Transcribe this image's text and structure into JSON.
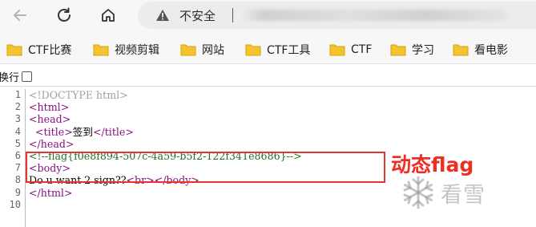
{
  "browser": {
    "security_label": "不安全",
    "nav": {
      "back_icon": "arrow-left-icon",
      "reload_icon": "reload-icon",
      "home_icon": "home-icon",
      "warn_icon": "warning-triangle-icon"
    }
  },
  "bookmarks": [
    {
      "label": "CTF比赛"
    },
    {
      "label": "视频剪辑"
    },
    {
      "label": "网站"
    },
    {
      "label": "CTF工具"
    },
    {
      "label": "CTF"
    },
    {
      "label": "学习"
    },
    {
      "label": "看电影"
    }
  ],
  "source_view": {
    "wrap_label": "换行",
    "wrap_checked": false,
    "line_numbers": [
      "1",
      "2",
      "3",
      "4",
      "5",
      "6",
      "7",
      "8",
      "9",
      "10"
    ],
    "lines": {
      "l1": "<!DOCTYPE html>",
      "l2": "<html>",
      "l3": "<head>",
      "l4_open": "  <title>",
      "l4_text": "签到",
      "l4_close": "</title>",
      "l5": "</head>",
      "l6": "<!--flag{f0e8f894-507c-4a59-b5f2-122f341e8686}-->",
      "l7": "<body>",
      "l8_text": "Do u want 2 sign??",
      "l8_tags": "<br></body>",
      "l9": "</html>",
      "l10": ""
    }
  },
  "annotation": {
    "label": "动态flag",
    "color": "#ee2d24"
  },
  "watermark": {
    "text": "看雪"
  }
}
